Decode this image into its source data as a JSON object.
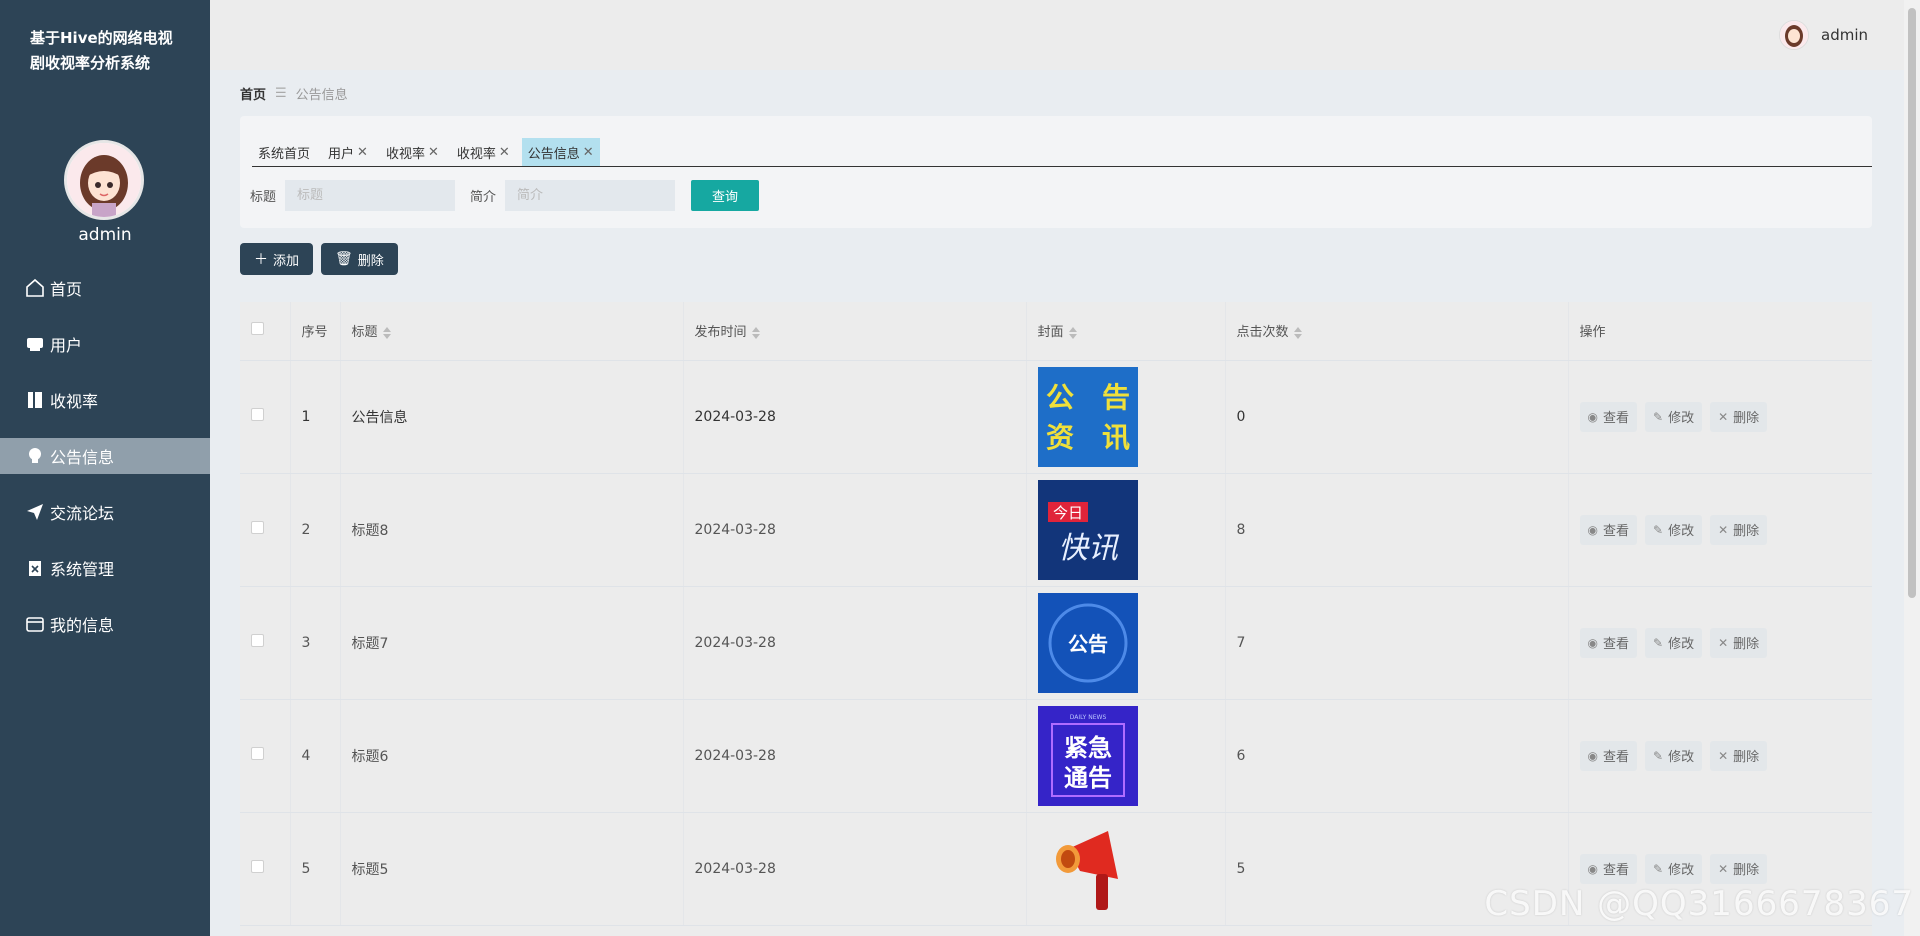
{
  "app": {
    "title": "基于Hive的网络电视剧收视率分析系统",
    "username": "admin",
    "header_username": "admin"
  },
  "menu": [
    {
      "label": "首页",
      "icon": "home-icon"
    },
    {
      "label": "用户",
      "icon": "user-card-icon"
    },
    {
      "label": "收视率",
      "icon": "book-icon"
    },
    {
      "label": "公告信息",
      "icon": "bulb-icon"
    },
    {
      "label": "交流论坛",
      "icon": "send-icon"
    },
    {
      "label": "系统管理",
      "icon": "clipboard-icon"
    },
    {
      "label": "我的信息",
      "icon": "wallet-icon"
    }
  ],
  "active_menu_index": 3,
  "breadcrumb": {
    "home": "首页",
    "current": "公告信息"
  },
  "tabs": [
    {
      "label": "系统首页",
      "closable": false
    },
    {
      "label": "用户",
      "closable": true
    },
    {
      "label": "收视率",
      "closable": true
    },
    {
      "label": "收视率",
      "closable": true
    },
    {
      "label": "公告信息",
      "closable": true
    }
  ],
  "search": {
    "title_label": "标题",
    "title_placeholder": "标题",
    "intro_label": "简介",
    "intro_placeholder": "简介",
    "query_button": "查询"
  },
  "actions": {
    "add": "添加",
    "delete": "删除"
  },
  "table": {
    "headers": {
      "index": "序号",
      "title": "标题",
      "publish_time": "发布时间",
      "cover": "封面",
      "clicks": "点击次数",
      "operations": "操作"
    },
    "row_buttons": {
      "view": "查看",
      "edit": "修改",
      "delete": "删除"
    },
    "rows": [
      {
        "index": "1",
        "title": "公告信息",
        "date": "2024-03-28",
        "clicks": "0",
        "cover_text": [
          "公　告",
          "资　讯"
        ]
      },
      {
        "index": "2",
        "title": "标题8",
        "date": "2024-03-28",
        "clicks": "8",
        "cover_text": [
          "今日",
          "快讯"
        ]
      },
      {
        "index": "3",
        "title": "标题7",
        "date": "2024-03-28",
        "clicks": "7",
        "cover_text": [
          "公告"
        ]
      },
      {
        "index": "4",
        "title": "标题6",
        "date": "2024-03-28",
        "clicks": "6",
        "cover_text": [
          "DAILY NEWS",
          "紧急",
          "通告"
        ]
      },
      {
        "index": "5",
        "title": "标题5",
        "date": "2024-03-28",
        "clicks": "5",
        "cover_text": []
      }
    ]
  },
  "watermark": "CSDN @QQ3166678367"
}
